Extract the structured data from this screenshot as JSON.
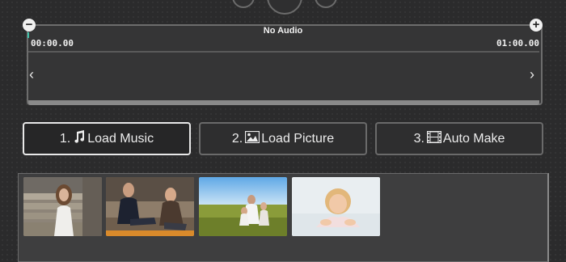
{
  "timeline": {
    "title": "No Audio",
    "start_time": "00:00.00",
    "end_time": "01:00.00",
    "zoom_out_symbol": "−",
    "zoom_in_symbol": "+",
    "prev_arrow": "‹",
    "next_arrow": "›"
  },
  "actions": {
    "load_music_prefix": "1.",
    "load_music_label": "Load Music",
    "load_picture_prefix": "2.",
    "load_picture_label": "Load Picture",
    "auto_make_prefix": "3.",
    "auto_make_label": "Auto Make"
  },
  "icons": {
    "music": "music-note-icon",
    "picture": "image-icon",
    "film": "film-icon"
  },
  "colors": {
    "background": "#2b2b2c",
    "accent": "#3fc0a8",
    "active_border": "#e8e8e8"
  }
}
